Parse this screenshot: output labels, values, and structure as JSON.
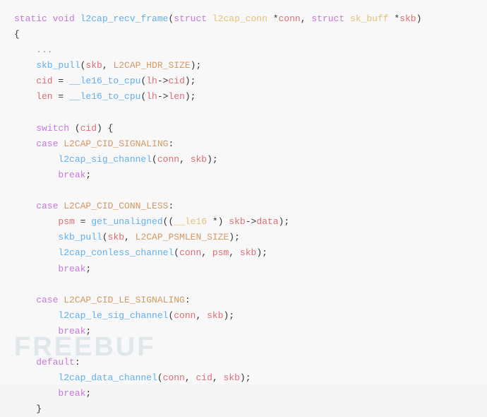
{
  "code": {
    "lines": [
      {
        "id": 1,
        "tokens": [
          {
            "text": "static ",
            "cls": "kw"
          },
          {
            "text": "void ",
            "cls": "kw"
          },
          {
            "text": "l2cap_recv_frame",
            "cls": "fn"
          },
          {
            "text": "(",
            "cls": "plain"
          },
          {
            "text": "struct ",
            "cls": "kw"
          },
          {
            "text": "l2cap_conn",
            "cls": "type"
          },
          {
            "text": " *",
            "cls": "plain"
          },
          {
            "text": "conn",
            "cls": "var"
          },
          {
            "text": ", ",
            "cls": "plain"
          },
          {
            "text": "struct ",
            "cls": "kw"
          },
          {
            "text": "sk_buff",
            "cls": "type"
          },
          {
            "text": " *",
            "cls": "plain"
          },
          {
            "text": "skb",
            "cls": "var"
          },
          {
            "text": ")",
            "cls": "plain"
          }
        ]
      },
      {
        "id": 2,
        "tokens": [
          {
            "text": "{",
            "cls": "plain"
          }
        ]
      },
      {
        "id": 3,
        "tokens": [
          {
            "text": "    ...",
            "cls": "comment"
          }
        ]
      },
      {
        "id": 4,
        "tokens": [
          {
            "text": "    skb_pull",
            "cls": "fn"
          },
          {
            "text": "(",
            "cls": "plain"
          },
          {
            "text": "skb",
            "cls": "var"
          },
          {
            "text": ", ",
            "cls": "plain"
          },
          {
            "text": "L2CAP_HDR_SIZE",
            "cls": "macro"
          },
          {
            "text": ");",
            "cls": "plain"
          }
        ]
      },
      {
        "id": 5,
        "tokens": [
          {
            "text": "    cid",
            "cls": "var"
          },
          {
            "text": " = ",
            "cls": "plain"
          },
          {
            "text": "__le16_to_cpu",
            "cls": "fn"
          },
          {
            "text": "(",
            "cls": "plain"
          },
          {
            "text": "lh",
            "cls": "var"
          },
          {
            "text": "->",
            "cls": "plain"
          },
          {
            "text": "cid",
            "cls": "var"
          },
          {
            "text": ");",
            "cls": "plain"
          }
        ]
      },
      {
        "id": 6,
        "tokens": [
          {
            "text": "    len",
            "cls": "var"
          },
          {
            "text": " = ",
            "cls": "plain"
          },
          {
            "text": "__le16_to_cpu",
            "cls": "fn"
          },
          {
            "text": "(",
            "cls": "plain"
          },
          {
            "text": "lh",
            "cls": "var"
          },
          {
            "text": "->",
            "cls": "plain"
          },
          {
            "text": "len",
            "cls": "var"
          },
          {
            "text": ");",
            "cls": "plain"
          }
        ]
      },
      {
        "id": 7,
        "tokens": [
          {
            "text": "",
            "cls": "plain"
          }
        ]
      },
      {
        "id": 8,
        "tokens": [
          {
            "text": "    switch",
            "cls": "kw"
          },
          {
            "text": " (",
            "cls": "plain"
          },
          {
            "text": "cid",
            "cls": "var"
          },
          {
            "text": ") {",
            "cls": "plain"
          }
        ]
      },
      {
        "id": 9,
        "tokens": [
          {
            "text": "    case ",
            "cls": "kw"
          },
          {
            "text": "L2CAP_CID_SIGNALING",
            "cls": "macro"
          },
          {
            "text": ":",
            "cls": "plain"
          }
        ]
      },
      {
        "id": 10,
        "tokens": [
          {
            "text": "        l2cap_sig_channel",
            "cls": "fn"
          },
          {
            "text": "(",
            "cls": "plain"
          },
          {
            "text": "conn",
            "cls": "var"
          },
          {
            "text": ", ",
            "cls": "plain"
          },
          {
            "text": "skb",
            "cls": "var"
          },
          {
            "text": ");",
            "cls": "plain"
          }
        ]
      },
      {
        "id": 11,
        "tokens": [
          {
            "text": "        break",
            "cls": "kw"
          },
          {
            "text": ";",
            "cls": "plain"
          }
        ]
      },
      {
        "id": 12,
        "tokens": [
          {
            "text": "",
            "cls": "plain"
          }
        ]
      },
      {
        "id": 13,
        "tokens": [
          {
            "text": "    case ",
            "cls": "kw"
          },
          {
            "text": "L2CAP_CID_CONN_LESS",
            "cls": "macro"
          },
          {
            "text": ":",
            "cls": "plain"
          }
        ]
      },
      {
        "id": 14,
        "tokens": [
          {
            "text": "        psm",
            "cls": "var"
          },
          {
            "text": " = ",
            "cls": "plain"
          },
          {
            "text": "get_unaligned",
            "cls": "fn"
          },
          {
            "text": "((",
            "cls": "plain"
          },
          {
            "text": "__le16",
            "cls": "type"
          },
          {
            "text": " *) ",
            "cls": "plain"
          },
          {
            "text": "skb",
            "cls": "var"
          },
          {
            "text": "->",
            "cls": "plain"
          },
          {
            "text": "data",
            "cls": "var"
          },
          {
            "text": ");",
            "cls": "plain"
          }
        ]
      },
      {
        "id": 15,
        "tokens": [
          {
            "text": "        skb_pull",
            "cls": "fn"
          },
          {
            "text": "(",
            "cls": "plain"
          },
          {
            "text": "skb",
            "cls": "var"
          },
          {
            "text": ", ",
            "cls": "plain"
          },
          {
            "text": "L2CAP_PSMLEN_SIZE",
            "cls": "macro"
          },
          {
            "text": ");",
            "cls": "plain"
          }
        ]
      },
      {
        "id": 16,
        "tokens": [
          {
            "text": "        l2cap_conless_channel",
            "cls": "fn"
          },
          {
            "text": "(",
            "cls": "plain"
          },
          {
            "text": "conn",
            "cls": "var"
          },
          {
            "text": ", ",
            "cls": "plain"
          },
          {
            "text": "psm",
            "cls": "var"
          },
          {
            "text": ", ",
            "cls": "plain"
          },
          {
            "text": "skb",
            "cls": "var"
          },
          {
            "text": ");",
            "cls": "plain"
          }
        ]
      },
      {
        "id": 17,
        "tokens": [
          {
            "text": "        break",
            "cls": "kw"
          },
          {
            "text": ";",
            "cls": "plain"
          }
        ]
      },
      {
        "id": 18,
        "tokens": [
          {
            "text": "",
            "cls": "plain"
          }
        ]
      },
      {
        "id": 19,
        "tokens": [
          {
            "text": "    case ",
            "cls": "kw"
          },
          {
            "text": "L2CAP_CID_LE_SIGNALING",
            "cls": "macro"
          },
          {
            "text": ":",
            "cls": "plain"
          }
        ]
      },
      {
        "id": 20,
        "tokens": [
          {
            "text": "        l2cap_le_sig_channel",
            "cls": "fn"
          },
          {
            "text": "(",
            "cls": "plain"
          },
          {
            "text": "conn",
            "cls": "var"
          },
          {
            "text": ", ",
            "cls": "plain"
          },
          {
            "text": "skb",
            "cls": "var"
          },
          {
            "text": ");",
            "cls": "plain"
          }
        ]
      },
      {
        "id": 21,
        "tokens": [
          {
            "text": "        break",
            "cls": "kw"
          },
          {
            "text": ";",
            "cls": "plain"
          }
        ]
      },
      {
        "id": 22,
        "tokens": [
          {
            "text": "",
            "cls": "plain"
          }
        ]
      },
      {
        "id": 23,
        "tokens": [
          {
            "text": "    default",
            "cls": "kw"
          },
          {
            "text": ":",
            "cls": "plain"
          }
        ]
      },
      {
        "id": 24,
        "tokens": [
          {
            "text": "        l2cap_data_channel",
            "cls": "fn"
          },
          {
            "text": "(",
            "cls": "plain"
          },
          {
            "text": "conn",
            "cls": "var"
          },
          {
            "text": ", ",
            "cls": "plain"
          },
          {
            "text": "cid",
            "cls": "var"
          },
          {
            "text": ", ",
            "cls": "plain"
          },
          {
            "text": "skb",
            "cls": "var"
          },
          {
            "text": ");",
            "cls": "plain"
          }
        ]
      },
      {
        "id": 25,
        "tokens": [
          {
            "text": "        break",
            "cls": "kw"
          },
          {
            "text": ";",
            "cls": "plain"
          }
        ]
      },
      {
        "id": 26,
        "tokens": [
          {
            "text": "    }",
            "cls": "plain"
          }
        ]
      }
    ],
    "watermark": "FREEBUF"
  }
}
